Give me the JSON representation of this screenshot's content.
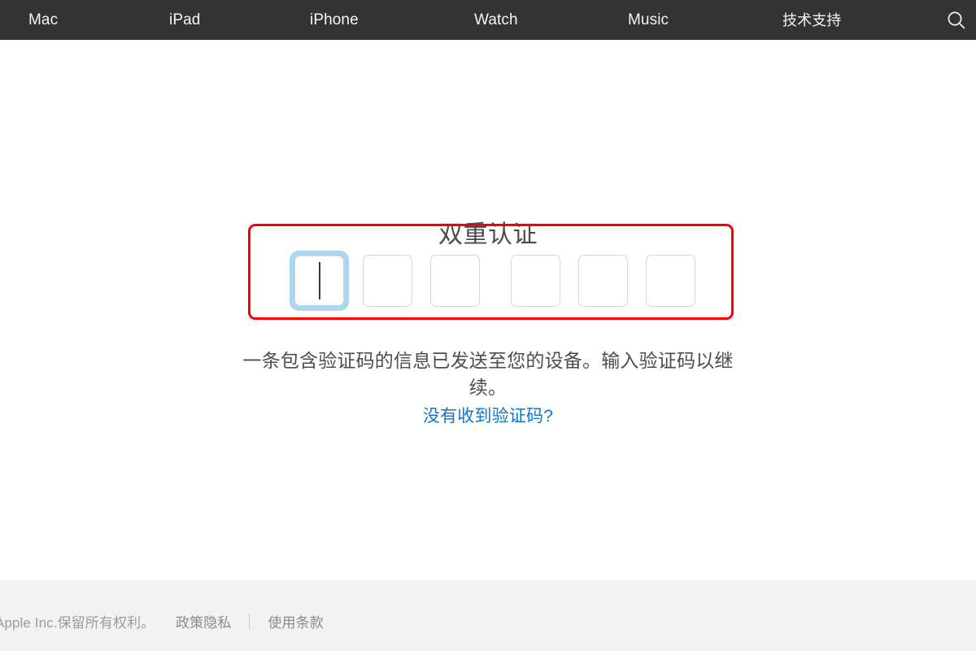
{
  "globalnav": {
    "background_color": "#333333",
    "items": [
      {
        "label": "Mac",
        "name": "nav-item-mac"
      },
      {
        "label": "iPad",
        "name": "nav-item-ipad"
      },
      {
        "label": "iPhone",
        "name": "nav-item-iphone"
      },
      {
        "label": "Watch",
        "name": "nav-item-watch"
      },
      {
        "label": "Music",
        "name": "nav-item-music"
      },
      {
        "label": "技术支持",
        "name": "nav-item-support"
      }
    ],
    "search_icon": "search-icon"
  },
  "auth": {
    "title": "双重认证",
    "description": "一条包含验证码的信息已发送至您的设备。输入验证码以继续。",
    "resend_link": "没有收到验证码?",
    "link_color": "#0a76d6",
    "code_length": 6,
    "code_values": [
      "",
      "",
      "",
      "",
      "",
      ""
    ],
    "focused_index": 0,
    "focus_ring_color": "#a9d7f2",
    "cell_border_color": "#d6d6d6"
  },
  "annotation": {
    "highlight_color": "#f90000",
    "highlight_target": "verification-code-inputs"
  },
  "footer": {
    "background_color": "#f2f2f2",
    "copyright": "Apple Inc.保留所有权利。",
    "links": [
      {
        "label": "政策隐私",
        "name": "footer-link-privacy"
      },
      {
        "label": "使用条款",
        "name": "footer-link-terms"
      }
    ]
  }
}
